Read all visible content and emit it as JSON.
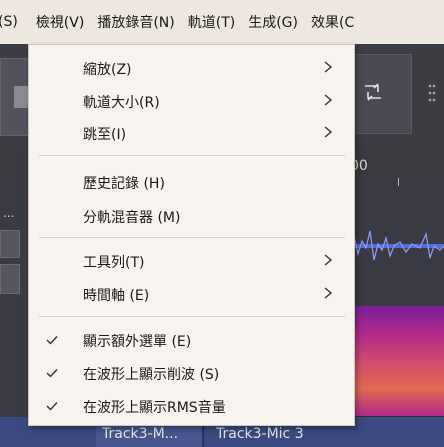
{
  "menubar": {
    "items": [
      "(S)",
      "檢視(V)",
      "播放錄音(N)",
      "軌道(T)",
      "生成(G)",
      "效果(C"
    ]
  },
  "dropdown": {
    "items": [
      {
        "label": "縮放(Z)",
        "submenu": true
      },
      {
        "label": "軌道大小(R)",
        "submenu": true
      },
      {
        "label": "跳至(I)",
        "submenu": true
      },
      {
        "label": "歷史記錄 (H)",
        "submenu": false
      },
      {
        "label": "分軌混音器 (M)",
        "submenu": false
      },
      {
        "label": "工具列(T)",
        "submenu": true
      },
      {
        "label": "時間軸 (E)",
        "submenu": true
      },
      {
        "label": "顯示額外選單 (E)",
        "checked": true
      },
      {
        "label": "在波形上顯示削波 (S)",
        "checked": true
      },
      {
        "label": "在波形上顯示RMS音量",
        "checked": true
      }
    ]
  },
  "background": {
    "ruler_label": "00",
    "clips": [
      "Track3-M...",
      "Track3-Mic 3"
    ]
  },
  "colors": {
    "menubar": "#eee7df",
    "dropdown": "#f7f3ef",
    "clip": "#3b4a80"
  }
}
